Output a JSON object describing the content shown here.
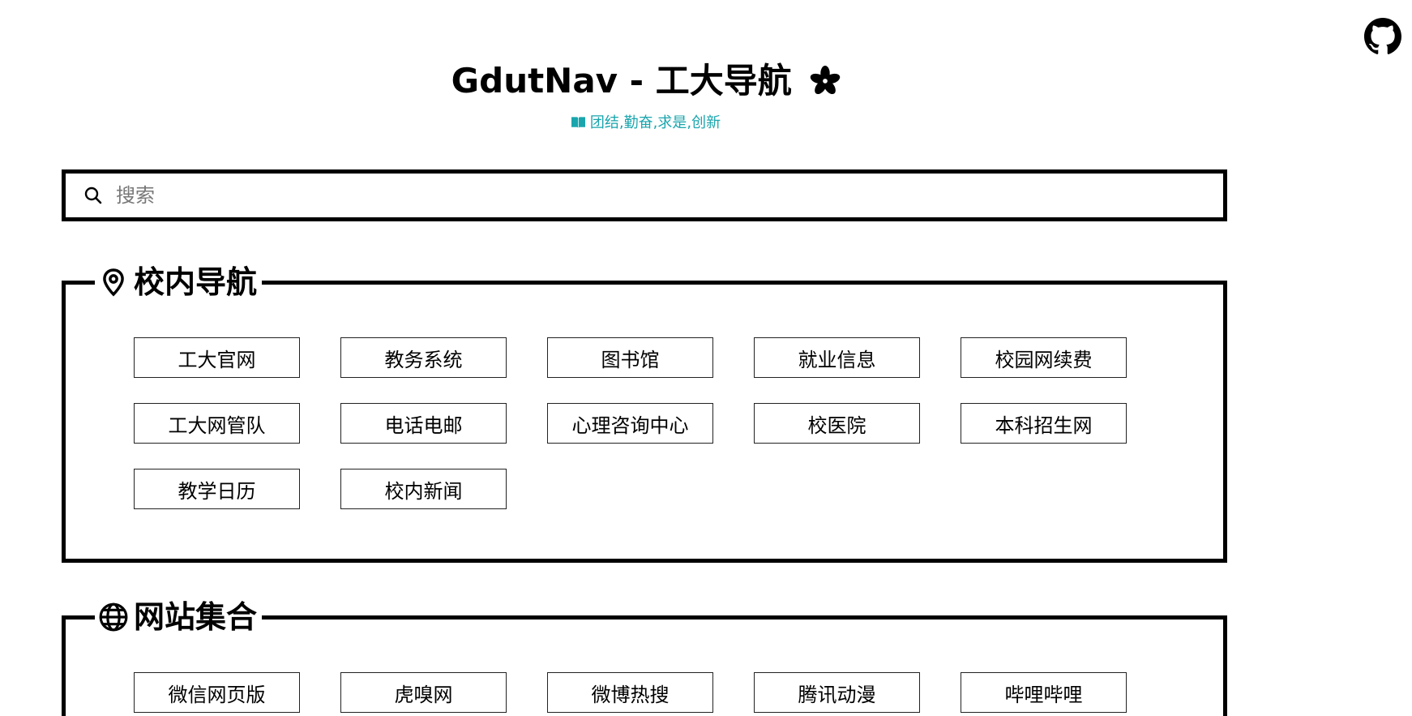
{
  "header": {
    "title": "GdutNav - 工大导航",
    "subtitle": "团结,勤奋,求是,创新",
    "github_icon": "github-icon",
    "flower_icon": "sakura-icon",
    "book_icon": "open-book-icon",
    "accent_color": "#1aa5ad"
  },
  "search": {
    "placeholder": "搜索",
    "value": "",
    "icon": "search-icon"
  },
  "sections": [
    {
      "title": "校内导航",
      "icon": "location-pin-icon",
      "links": [
        "工大官网",
        "教务系统",
        "图书馆",
        "就业信息",
        "校园网续费",
        "工大网管队",
        "电话电邮",
        "心理咨询中心",
        "校医院",
        "本科招生网",
        "教学日历",
        "校内新闻"
      ]
    },
    {
      "title": "网站集合",
      "icon": "globe-icon",
      "links": [
        "微信网页版",
        "虎嗅网",
        "微博热搜",
        "腾讯动漫",
        "哔哩哔哩"
      ]
    }
  ]
}
